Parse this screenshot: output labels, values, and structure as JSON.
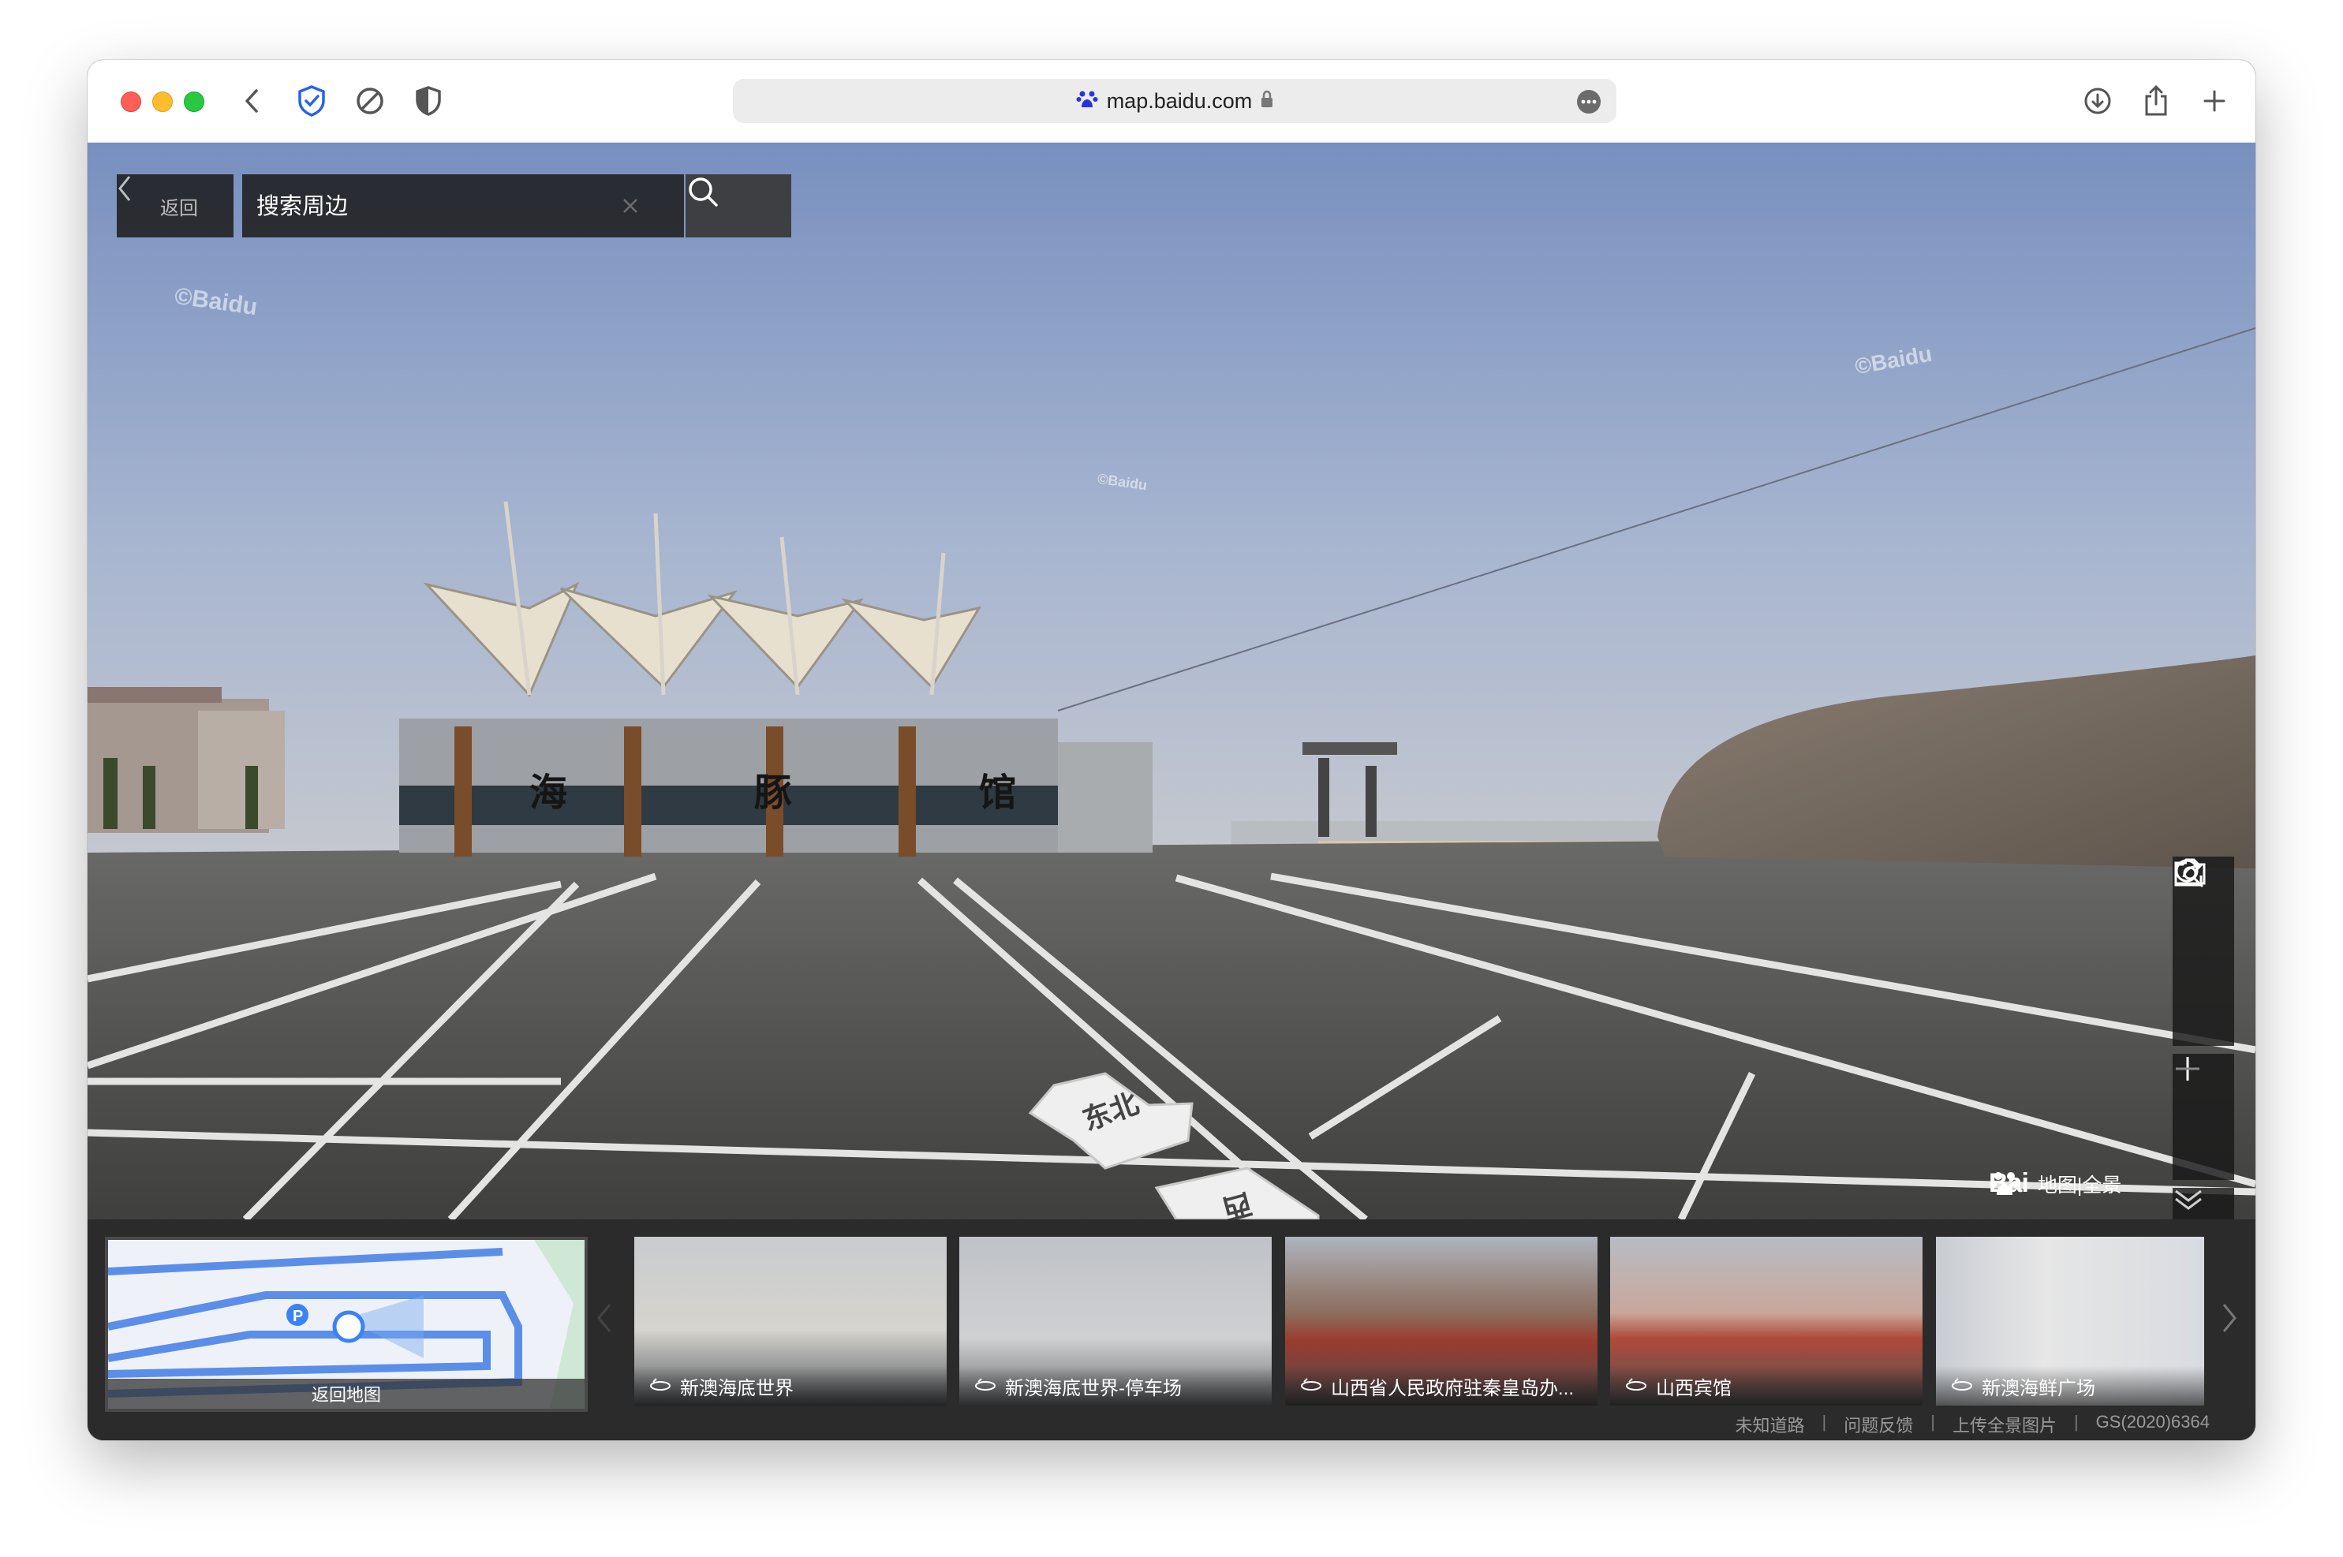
{
  "browser": {
    "url": "map.baidu.com"
  },
  "panorama": {
    "back_label": "返回",
    "search_placeholder": "搜索周边",
    "watermark": "©Baidu",
    "building_sign": "海 豚 馆",
    "arrow_forward_label": "东北",
    "arrow_back_label": "西",
    "logo": {
      "brand": "Bai",
      "product": "地图|全景"
    }
  },
  "controls": {
    "icons": [
      "search-icon",
      "camera-icon",
      "share-icon",
      "zoom-in-icon",
      "zoom-out-icon",
      "collapse-icon"
    ]
  },
  "strip": {
    "minimap_label": "返回地图",
    "thumbnails": [
      {
        "label": "新澳海底世界"
      },
      {
        "label": "新澳海底世界-停车场"
      },
      {
        "label": "山西省人民政府驻秦皇岛办..."
      },
      {
        "label": "山西宾馆"
      },
      {
        "label": "新澳海鲜广场"
      }
    ],
    "footer": {
      "road": "未知道路",
      "feedback": "问题反馈",
      "upload": "上传全景图片",
      "license": "GS(2020)6364"
    }
  },
  "colors": {
    "sky_top": "#7b94c2",
    "sky_bottom": "#b3bfd4",
    "ground": "#4a4a48",
    "accent_blue": "#3b82f6"
  }
}
